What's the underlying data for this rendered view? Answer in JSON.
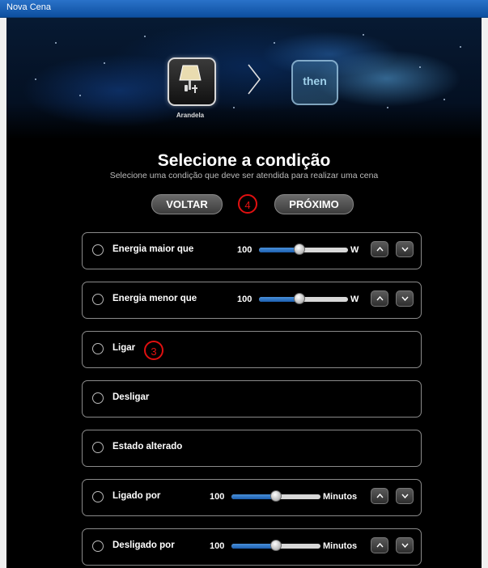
{
  "window": {
    "title": "Nova Cena"
  },
  "wizard": {
    "device_label": "Arandela",
    "device_icon": "wall-lamp-icon",
    "then_label": "then",
    "heading": "Selecione a condição",
    "subheading": "Selecione uma condição que deve ser atendida para realizar uma cena",
    "back_label": "VOLTAR",
    "next_label": "PRÓXIMO",
    "badge_next": "4",
    "badge_ligar": "3"
  },
  "conditions": [
    {
      "label": "Energia maior que",
      "value": "100",
      "unit": "W",
      "slider_fraction": 0.45
    },
    {
      "label": "Energia menor que",
      "value": "100",
      "unit": "W",
      "slider_fraction": 0.45
    },
    {
      "label": "Ligar"
    },
    {
      "label": "Desligar"
    },
    {
      "label": "Estado alterado"
    },
    {
      "label": "Ligado por",
      "value": "100",
      "unit": "Minutos",
      "slider_fraction": 0.5
    },
    {
      "label": "Desligado por",
      "value": "100",
      "unit": "Minutos",
      "slider_fraction": 0.5
    }
  ],
  "colors": {
    "accent": "#1c5fb0",
    "badge": "#e01010",
    "titlebar": "#2a72c9"
  }
}
